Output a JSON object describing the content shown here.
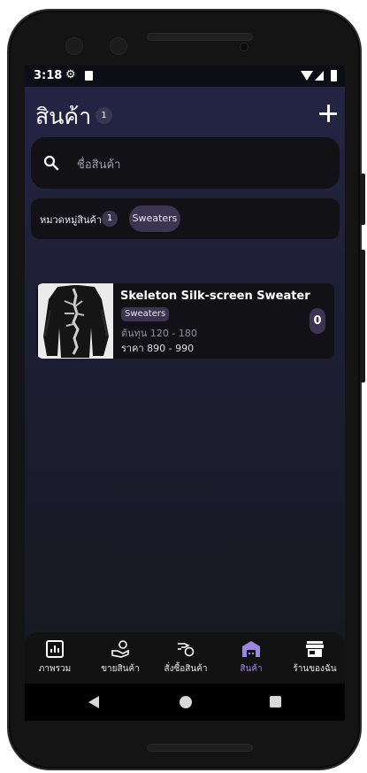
{
  "status_bar": {
    "time": "3:18",
    "icons": [
      "gear-icon",
      "sd-card-icon",
      "wifi-icon",
      "signal-icon",
      "battery-icon"
    ]
  },
  "header": {
    "title": "สินค้า",
    "count": "1",
    "add_icon": "plus-icon"
  },
  "search": {
    "placeholder": "ชื่อสินค้า",
    "icon": "search-icon"
  },
  "filter": {
    "label": "หมวดหมู่สินค้า",
    "count": "1",
    "chips": [
      "Sweaters"
    ]
  },
  "products": [
    {
      "name": "Skeleton Silk-screen Sweater",
      "category": "Sweaters",
      "cost": "ต้นทุน 120 - 180",
      "price": "ราคา 890 - 990",
      "stock": "0"
    }
  ],
  "bottom_nav": {
    "items": [
      {
        "label": "ภาพรวม",
        "icon": "chart-icon"
      },
      {
        "label": "ขายสินค้า",
        "icon": "sell-hand-icon"
      },
      {
        "label": "สั่งซื้อสินค้า",
        "icon": "purchase-hand-icon"
      },
      {
        "label": "สินค้า",
        "icon": "warehouse-icon"
      },
      {
        "label": "ร้านของฉัน",
        "icon": "store-icon"
      }
    ],
    "active_index": 3
  },
  "colors": {
    "accent": "#9e86e0",
    "chip": "#3b3551",
    "surface": "#121216",
    "background_top": "#242546"
  }
}
